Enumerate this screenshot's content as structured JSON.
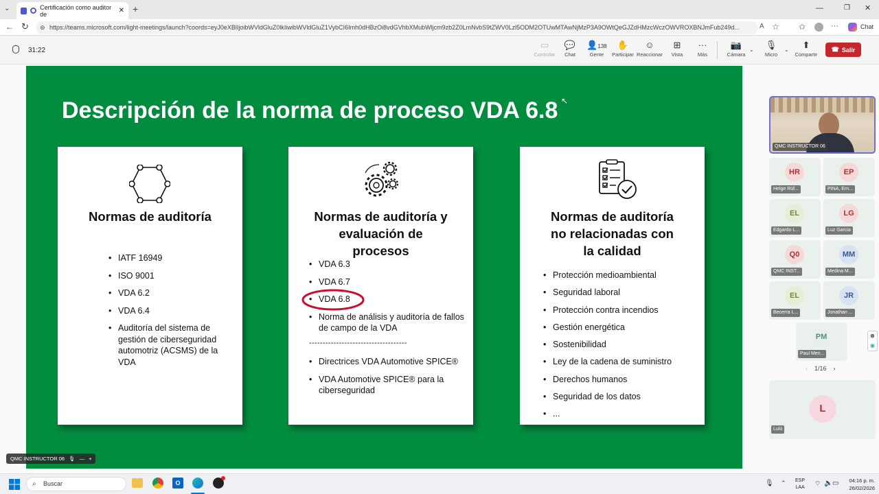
{
  "browser": {
    "tab_title": "Certificación como auditor de",
    "url": "https://teams.microsoft.com/light-meetings/launch?coords=eyJ0eXBlIjoibWVldGluZ0lkIiwibWVldGluZ1VybCI6Imh0dHBzOi8vdGVhbXMubWljcm9zb2Z0LmNvbS9tZWV0Lzl5ODM2OTUwMTAwNjMzP3A9OWtQeGJZdHMzcWczOWVROXBNJmFub249d...",
    "chat_label": "Chat"
  },
  "meeting": {
    "timer": "31:22",
    "toolbar": {
      "controlar": "Controlar",
      "chat": "Chat",
      "people_count": "138",
      "people": "Gente",
      "raise": "Participar",
      "react": "Reaccionar",
      "view": "Vista",
      "more": "Más",
      "camera": "Cámara",
      "mic": "Micro",
      "share": "Compartir",
      "leave": "Salir"
    },
    "presenter_label": "QMC INSTRUCTOR 06"
  },
  "slide": {
    "title": "Descripción de la norma de proceso VDA 6.8",
    "cards": [
      {
        "title": "Normas de auditoría",
        "icon": "hexagon-network-icon",
        "items": [
          "IATF 16949",
          "ISO 9001",
          "VDA 6.2",
          "VDA 6.4",
          "Auditoría del sistema de gestión de ciberseguridad automotriz (ACSMS) de la VDA"
        ]
      },
      {
        "title_lines": [
          "Normas de auditoría y",
          "evaluación de",
          "procesos"
        ],
        "icon": "gears-icon",
        "items": [
          "VDA 6.3",
          "VDA 6.7",
          "VDA 6.8",
          "Norma de análisis y auditoría de fallos de campo de la VDA"
        ],
        "divider": "------------------------------------",
        "items2": [
          "Directrices VDA Automotive SPICE®",
          "VDA Automotive SPICE® para la ciberseguridad"
        ]
      },
      {
        "title_lines": [
          "Normas de auditoría",
          "no relacionadas con",
          "la calidad"
        ],
        "icon": "checklist-icon",
        "items": [
          "Protección medioambiental",
          "Seguridad laboral",
          "Protección contra incendios",
          "Gestión energética",
          "Sostenibilidad",
          "Ley de la cadena de suministro",
          "Derechos humanos",
          "Seguridad de los datos",
          "..."
        ]
      }
    ],
    "highlight_color": "#c8102e"
  },
  "roster": {
    "main_video_label": "QMC INSTRUCTOR 06",
    "participants": [
      {
        "initials": "HR",
        "name": "Helge Rüf...",
        "color": "#f7d8d8",
        "text": "#a33"
      },
      {
        "initials": "EP",
        "name": "PINA, Ern...",
        "color": "#f7d8d8",
        "text": "#a33"
      },
      {
        "initials": "EL",
        "name": "Edgardo L...",
        "color": "#e6efd6",
        "text": "#6a8a3a"
      },
      {
        "initials": "LG",
        "name": "Luz Garcia",
        "color": "#f7d8d8",
        "text": "#a33"
      },
      {
        "initials": "Q0",
        "name": "QMC INST...",
        "color": "#f7d8d8",
        "text": "#a33"
      },
      {
        "initials": "MM",
        "name": "Medina M...",
        "color": "#d8e2f3",
        "text": "#3a5a8a"
      },
      {
        "initials": "EL",
        "name": "Becerra L...",
        "color": "#e6efd6",
        "text": "#6a8a3a"
      },
      {
        "initials": "JR",
        "name": "Jonathan ...",
        "color": "#d8e2f3",
        "text": "#3a5a8a"
      },
      {
        "initials": "PM",
        "name": "Paul Men...",
        "color": "#e8f0ee",
        "text": "#5a8a80"
      }
    ],
    "pager": "1/16",
    "large": {
      "initials": "L",
      "name": "Lulú",
      "color": "#f7d8e0",
      "text": "#a33"
    }
  },
  "taskbar": {
    "search": "Buscar",
    "lang": "ESP",
    "lang2": "LAA",
    "time": "04:16 p. m.",
    "date": "26/02/2026"
  }
}
